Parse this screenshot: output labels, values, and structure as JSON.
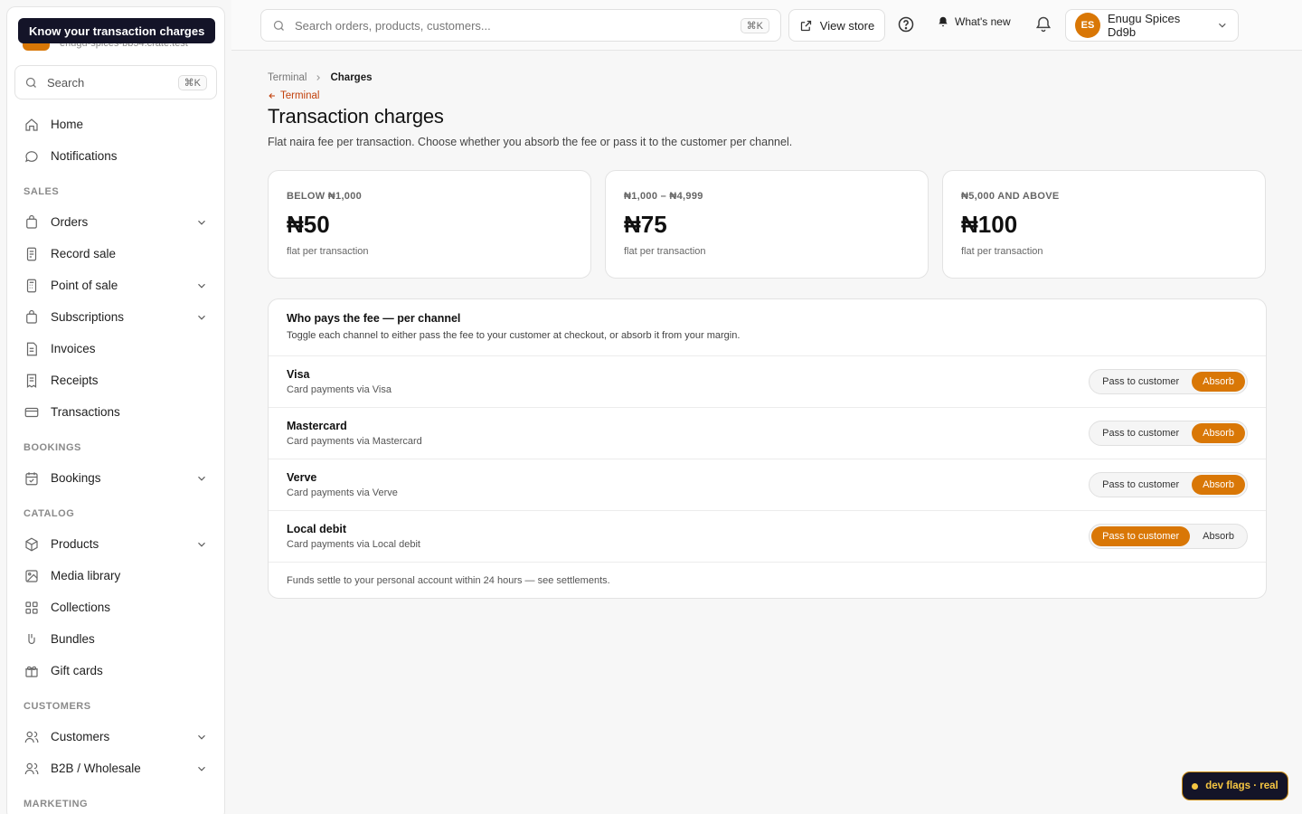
{
  "tooltip": "Know your transaction charges",
  "sidebar": {
    "store_url": "enugu-spices-bb54.crate.test",
    "search_label": "Search",
    "search_kbd": "⌘K",
    "top": [
      {
        "label": "Home"
      },
      {
        "label": "Notifications"
      }
    ],
    "sections": [
      {
        "title": "SALES",
        "items": [
          {
            "label": "Orders",
            "chevron": true
          },
          {
            "label": "Record sale"
          },
          {
            "label": "Point of sale",
            "chevron": true
          },
          {
            "label": "Subscriptions",
            "chevron": true
          },
          {
            "label": "Invoices"
          },
          {
            "label": "Receipts"
          },
          {
            "label": "Transactions"
          }
        ]
      },
      {
        "title": "BOOKINGS",
        "items": [
          {
            "label": "Bookings",
            "chevron": true
          }
        ]
      },
      {
        "title": "CATALOG",
        "items": [
          {
            "label": "Products",
            "chevron": true
          },
          {
            "label": "Media library"
          },
          {
            "label": "Collections"
          },
          {
            "label": "Bundles"
          },
          {
            "label": "Gift cards"
          }
        ]
      },
      {
        "title": "CUSTOMERS",
        "items": [
          {
            "label": "Customers",
            "chevron": true
          },
          {
            "label": "B2B / Wholesale",
            "chevron": true
          }
        ]
      },
      {
        "title": "MARKETING",
        "items": []
      }
    ]
  },
  "topbar": {
    "search_placeholder": "Search orders, products, customers...",
    "search_kbd": "⌘K",
    "view_store": "View store",
    "whats_new": "What's new",
    "account_initials": "ES",
    "account_name": "Enugu Spices Dd9b"
  },
  "page": {
    "breadcrumb_parent": "Terminal",
    "breadcrumb_current": "Charges",
    "back_label": "Terminal",
    "title": "Transaction charges",
    "subtitle": "Flat naira fee per transaction. Choose whether you absorb the fee or pass it to the customer per channel."
  },
  "tiers": [
    {
      "label": "BELOW ₦1,000",
      "amount": "₦50",
      "note": "flat per transaction"
    },
    {
      "label": "₦1,000 – ₦4,999",
      "amount": "₦75",
      "note": "flat per transaction"
    },
    {
      "label": "₦5,000 AND ABOVE",
      "amount": "₦100",
      "note": "flat per transaction"
    }
  ],
  "fee_panel": {
    "title": "Who pays the fee — per channel",
    "description": "Toggle each channel to either pass the fee to your customer at checkout, or absorb it from your margin.",
    "option_pass": "Pass to customer",
    "option_absorb": "Absorb",
    "channels": [
      {
        "name": "Visa",
        "description": "Card payments via Visa",
        "selected": "absorb"
      },
      {
        "name": "Mastercard",
        "description": "Card payments via Mastercard",
        "selected": "absorb"
      },
      {
        "name": "Verve",
        "description": "Card payments via Verve",
        "selected": "absorb"
      },
      {
        "name": "Local debit",
        "description": "Card payments via Local debit",
        "selected": "pass"
      }
    ],
    "footer": "Funds settle to your personal account within 24 hours — see settlements."
  },
  "dev_flags": "dev flags · real",
  "colors": {
    "accent": "#d97706",
    "dark": "#141428"
  }
}
